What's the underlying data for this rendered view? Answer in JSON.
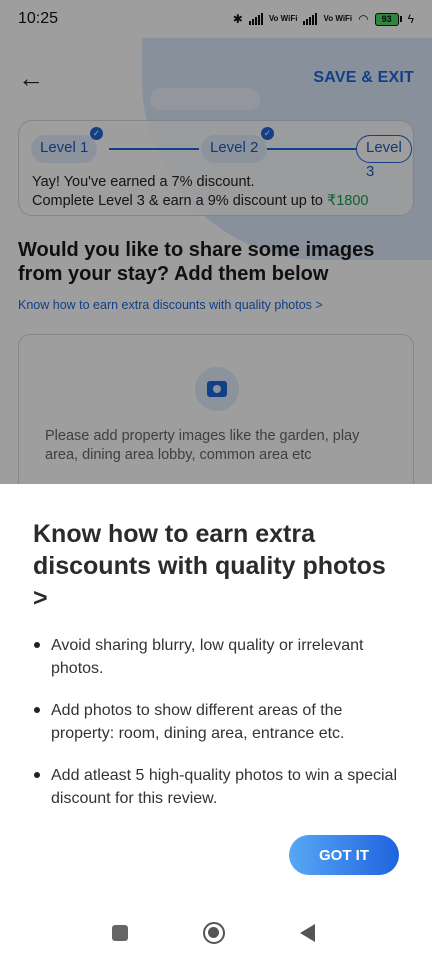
{
  "status_bar": {
    "time": "10:25",
    "network_label": "Vo WiFi",
    "battery": "93"
  },
  "header": {
    "save_exit_label": "SAVE & EXIT"
  },
  "levels": {
    "items": [
      {
        "label": "Level 1",
        "completed": true
      },
      {
        "label": "Level 2",
        "completed": true
      },
      {
        "label": "Level 3",
        "completed": false
      }
    ],
    "message_line1": "Yay! You've earned a 7% discount.",
    "message_line2": "Complete Level 3 & earn a 9% discount up to",
    "amount": "₹1800"
  },
  "main": {
    "question": "Would you like to share some images from your stay? Add them below",
    "know_link": "Know how to earn extra discounts with quality photos >",
    "upload_hint": "Please add property images like the garden, play area, dining area lobby, common area etc"
  },
  "sheet": {
    "title": "Know how to earn extra discounts with quality photos >",
    "tips": [
      "Avoid sharing blurry, low quality or irrelevant photos.",
      "Add photos to show different areas of the property: room, dining area, entrance etc.",
      "Add atleast 5 high-quality photos to win a special discount for this review."
    ],
    "got_it_label": "GOT IT"
  },
  "colors": {
    "accent": "#1e66d8",
    "amount": "#1a9a52",
    "overlay": "#000000"
  }
}
